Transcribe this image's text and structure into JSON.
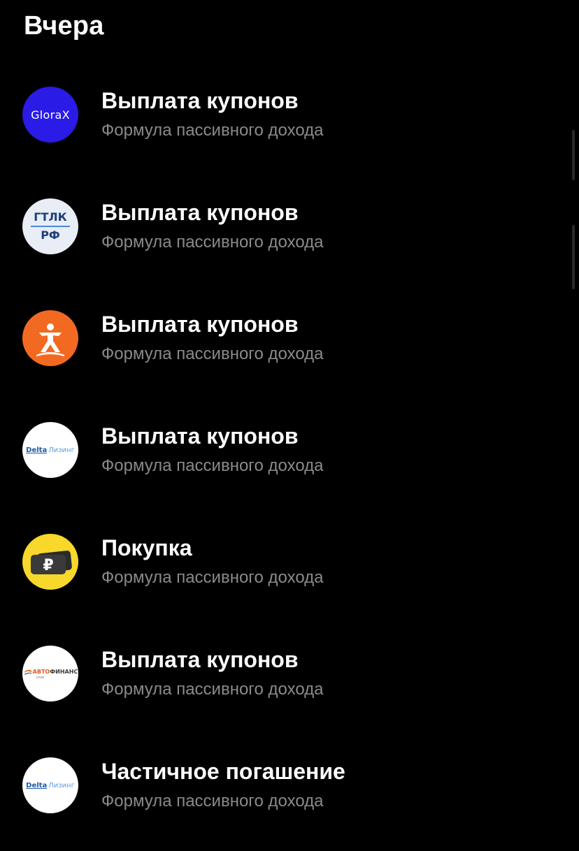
{
  "section": {
    "title": "Вчера"
  },
  "colors": {
    "background": "#000000",
    "title": "#ffffff",
    "subtitle": "#8a8a8e"
  },
  "operations": [
    {
      "title": "Выплата купонов",
      "subtitle": "Формула пассивного дохода",
      "logo": {
        "icon": "glorax-logo",
        "text": "GloraX"
      }
    },
    {
      "title": "Выплата купонов",
      "subtitle": "Формула пассивного дохода",
      "logo": {
        "icon": "gtlk-logo",
        "line1": "ГТЛК",
        "line2": "РФ"
      }
    },
    {
      "title": "Выплата купонов",
      "subtitle": "Формула пассивного дохода",
      "logo": {
        "icon": "orange-figure-logo"
      }
    },
    {
      "title": "Выплата купонов",
      "subtitle": "Формула пассивного дохода",
      "logo": {
        "icon": "delta-leasing-logo",
        "brand": "Delta",
        "word": "Лизинг"
      }
    },
    {
      "title": "Покупка",
      "subtitle": "Формула пассивного дохода",
      "logo": {
        "icon": "ruble-card-logo",
        "symbol": "₽"
      }
    },
    {
      "title": "Выплата купонов",
      "subtitle": "Формула пассивного дохода",
      "logo": {
        "icon": "avtofinance-bank-logo",
        "part1": "АВТО",
        "part2": "ФИНАНС",
        "part3": "БАНК"
      }
    },
    {
      "title": "Частичное погашение",
      "subtitle": "Формула пассивного дохода",
      "logo": {
        "icon": "delta-leasing-logo",
        "brand": "Delta",
        "word": "Лизинг"
      }
    }
  ]
}
